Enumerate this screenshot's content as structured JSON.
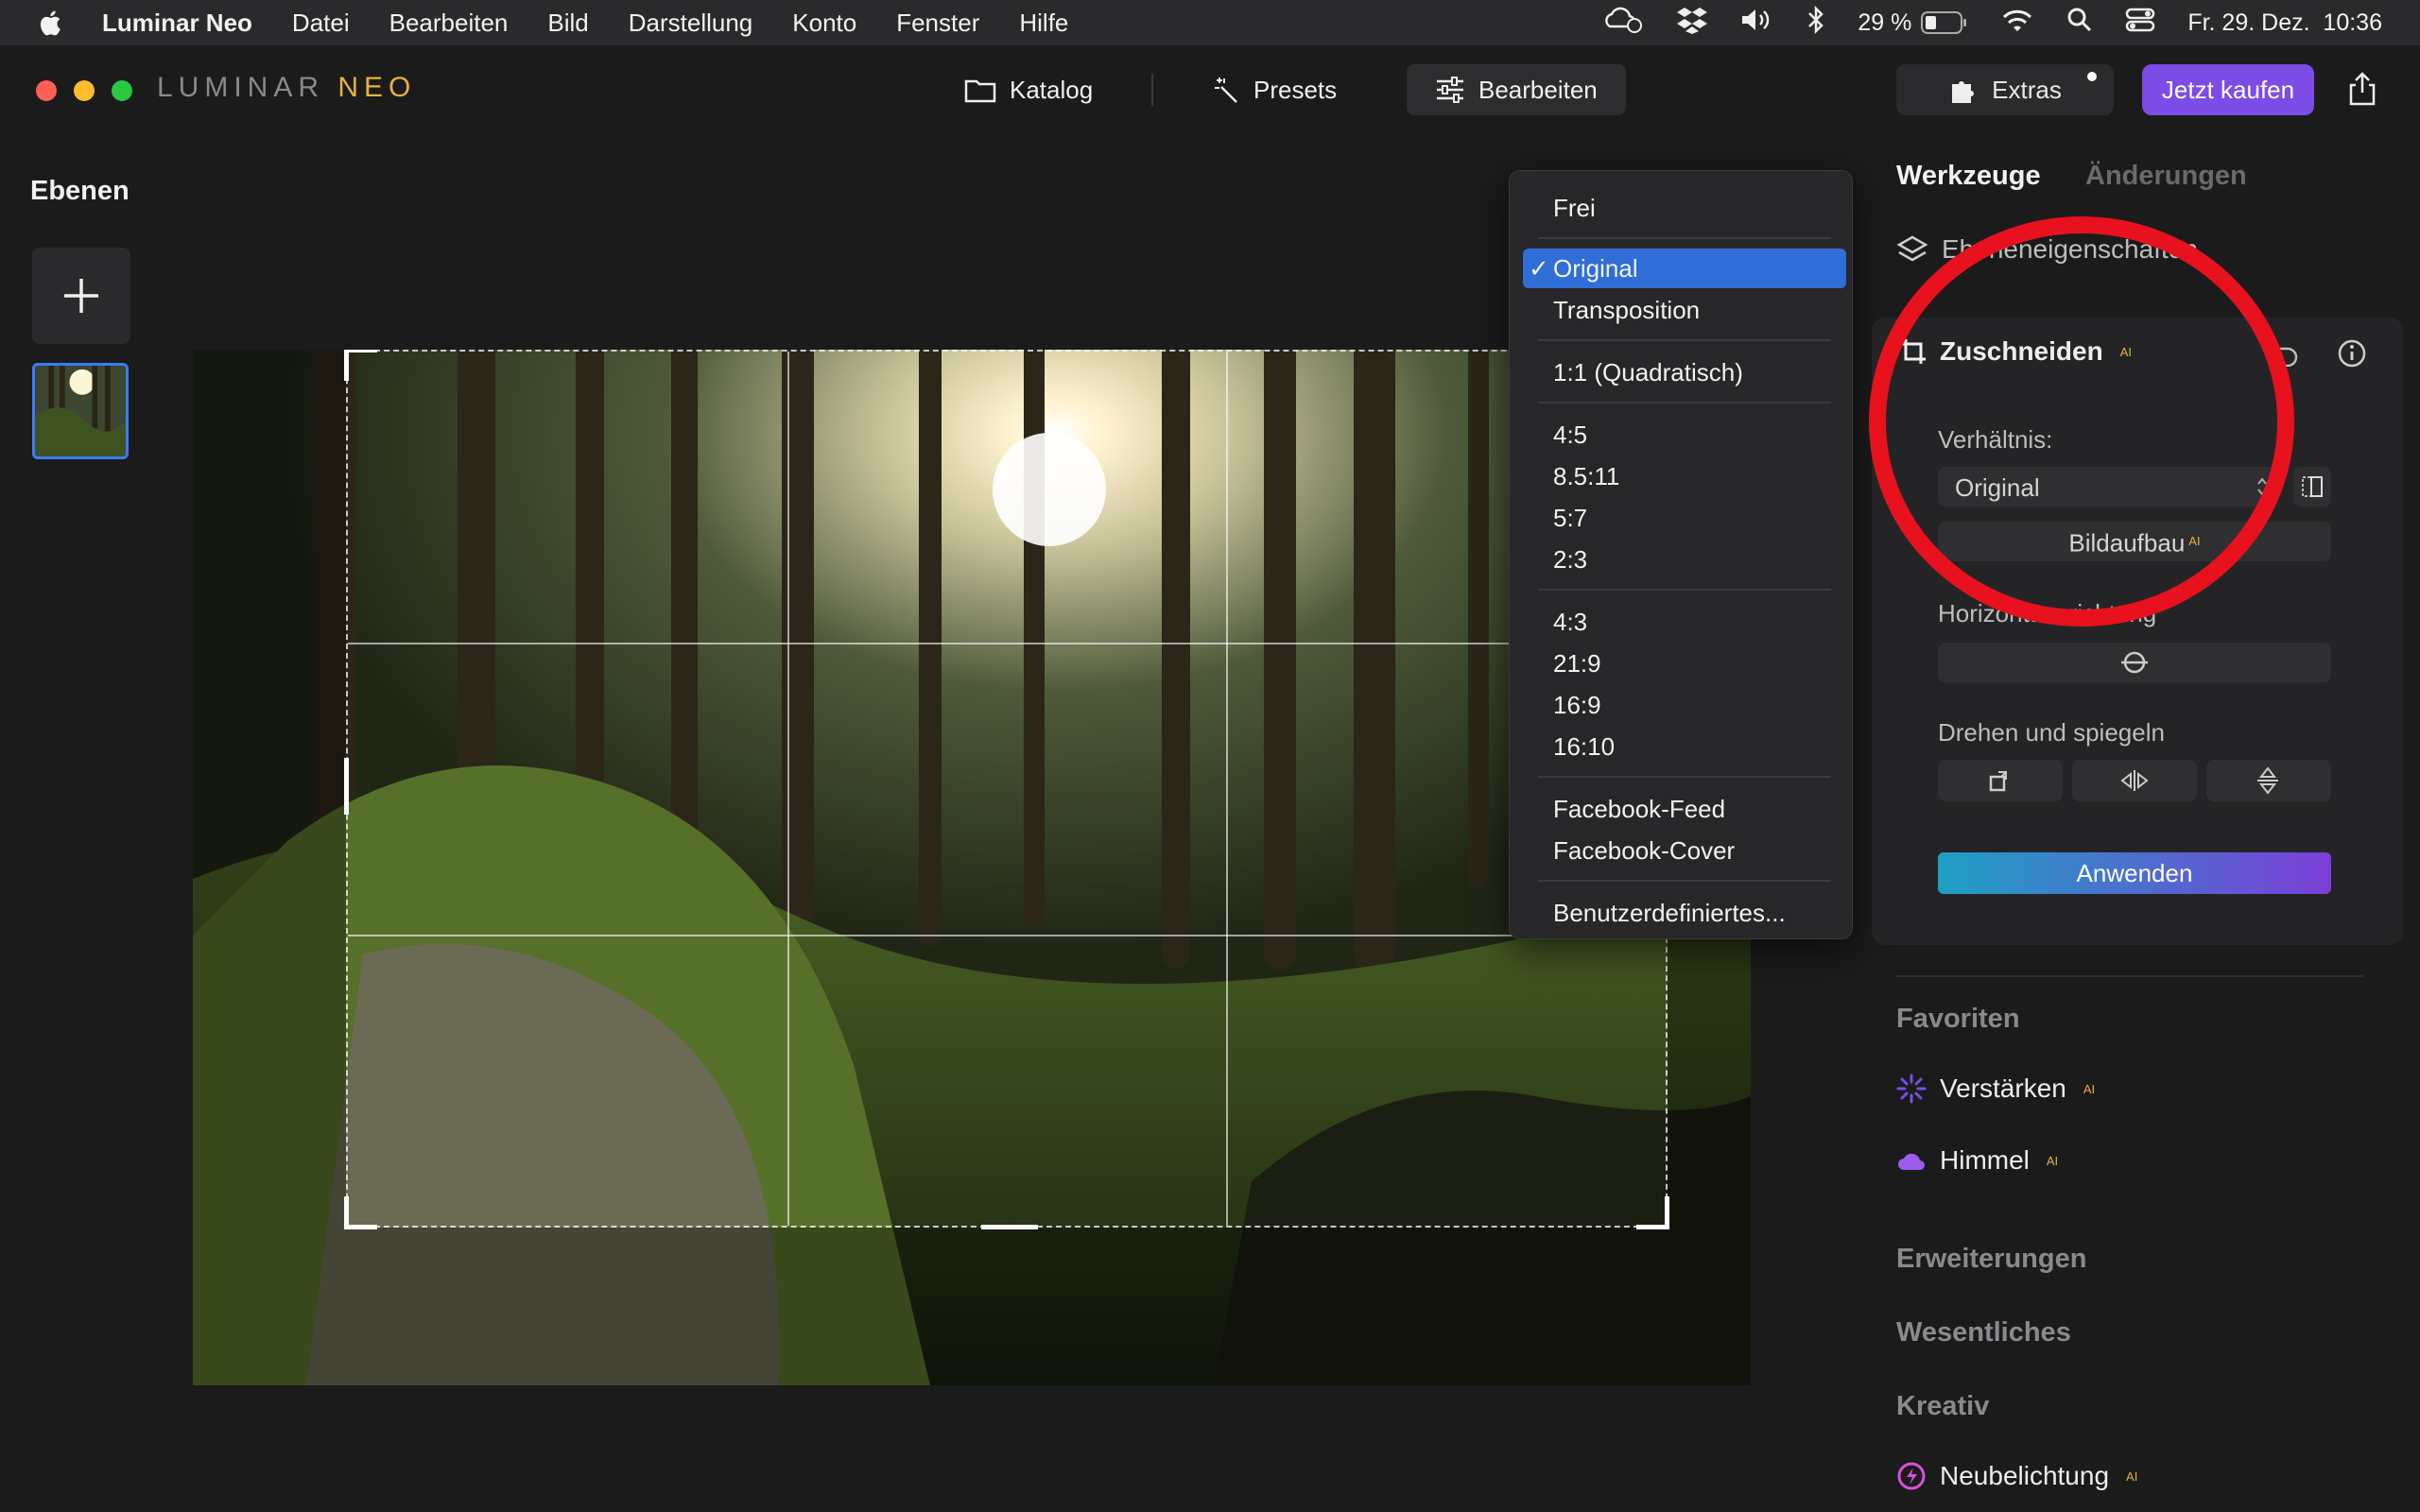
{
  "menubar": {
    "app_name": "Luminar Neo",
    "menus": [
      "Datei",
      "Bearbeiten",
      "Bild",
      "Darstellung",
      "Konto",
      "Fenster",
      "Hilfe"
    ],
    "battery": "29 %",
    "datetime": "Fr. 29. Dez.  10:36"
  },
  "app": {
    "logo_luminar": "LUMINAR",
    "logo_neo": "NEO",
    "nav": {
      "katalog": "Katalog",
      "presets": "Presets",
      "bearbeiten": "Bearbeiten"
    },
    "extras": "Extras",
    "buy": "Jetzt kaufen"
  },
  "layers": {
    "title": "Ebenen"
  },
  "ratio_menu": {
    "items": [
      "Frei",
      "Original",
      "Transposition",
      "1:1 (Quadratisch)",
      "4:5",
      "8.5:11",
      "5:7",
      "2:3",
      "4:3",
      "21:9",
      "16:9",
      "16:10",
      "Facebook-Feed",
      "Facebook-Cover",
      "Benutzerdefiniertes..."
    ],
    "selected": "Original",
    "checkmark": "✓"
  },
  "tools": {
    "tab_tools": "Werkzeuge",
    "tab_changes": "Änderungen",
    "layer_props": "Ebeneneigenschaften",
    "crop": {
      "title": "Zuschneiden",
      "ai": "AI",
      "ratio_label": "Verhältnis:",
      "ratio_value": "Original",
      "composition": "Bildaufbau",
      "horizon_label": "Horizontausrichtung",
      "rotate_label": "Drehen und spiegeln",
      "apply": "Anwenden"
    },
    "favorites": "Favoriten",
    "enhance": "Verstärken",
    "sky": "Himmel",
    "extensions": "Erweiterungen",
    "essentials": "Wesentliches",
    "creative": "Kreativ",
    "relight": "Neubelichtung"
  },
  "colors": {
    "accent": "#7c4ce6",
    "selection": "#2f6ed6",
    "annotation_circle": "#e8111e"
  }
}
